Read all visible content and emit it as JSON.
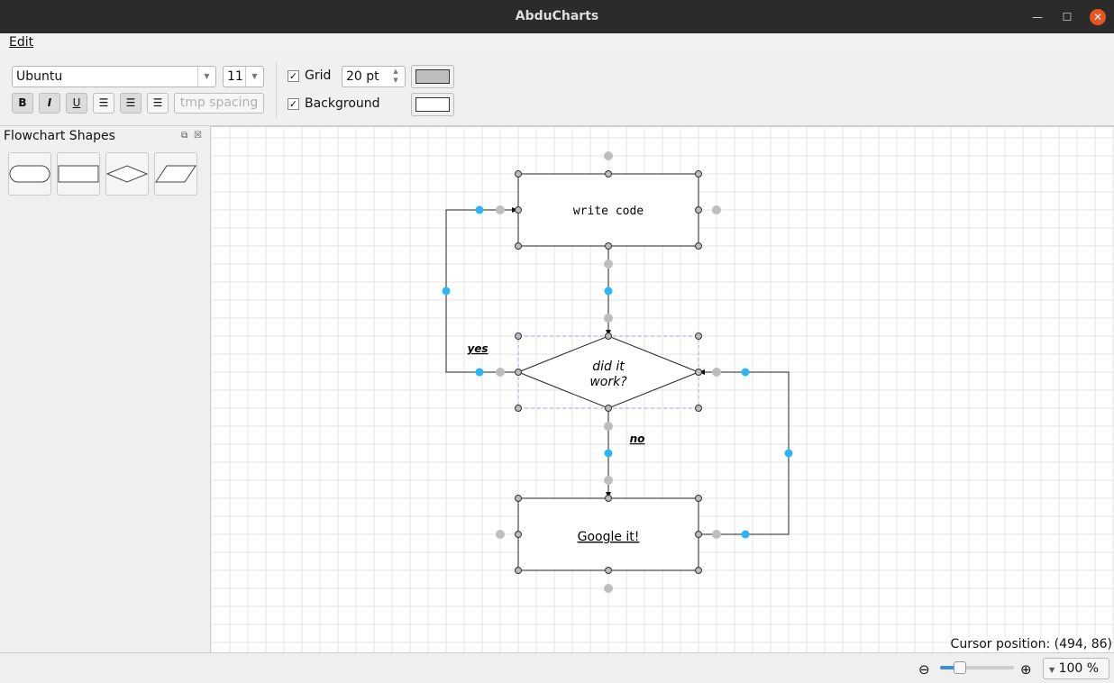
{
  "window": {
    "title": "AbduCharts"
  },
  "menu": {
    "edit": "Edit"
  },
  "toolbar": {
    "font": "Ubuntu",
    "font_size": "11",
    "bold": "B",
    "italic": "I",
    "underline": "U",
    "spacing_button": "tmp spacing",
    "grid_label": "Grid",
    "grid_checked": true,
    "grid_size": "20 pt",
    "grid_color": "#bebebe",
    "background_label": "Background",
    "background_checked": true,
    "background_color": "#ffffff"
  },
  "panel": {
    "title": "Flowchart Shapes",
    "shapes": [
      "terminator",
      "process",
      "decision",
      "data"
    ]
  },
  "diagram": {
    "nodes": [
      {
        "id": "write",
        "text": "write code"
      },
      {
        "id": "decide",
        "text_line1": "did it",
        "text_line2": "work?"
      },
      {
        "id": "google",
        "text": "Google it!"
      }
    ],
    "edges": [
      {
        "from": "write",
        "to": "decide"
      },
      {
        "from": "decide",
        "to": "write",
        "label": "yes"
      },
      {
        "from": "decide",
        "to": "google",
        "label": "no"
      },
      {
        "from": "google",
        "to": "decide"
      }
    ],
    "accent": "#29b6f6"
  },
  "status": {
    "cursor": "Cursor position: (494, 86)",
    "zoom": "100 %",
    "zoom_percent": 100
  }
}
